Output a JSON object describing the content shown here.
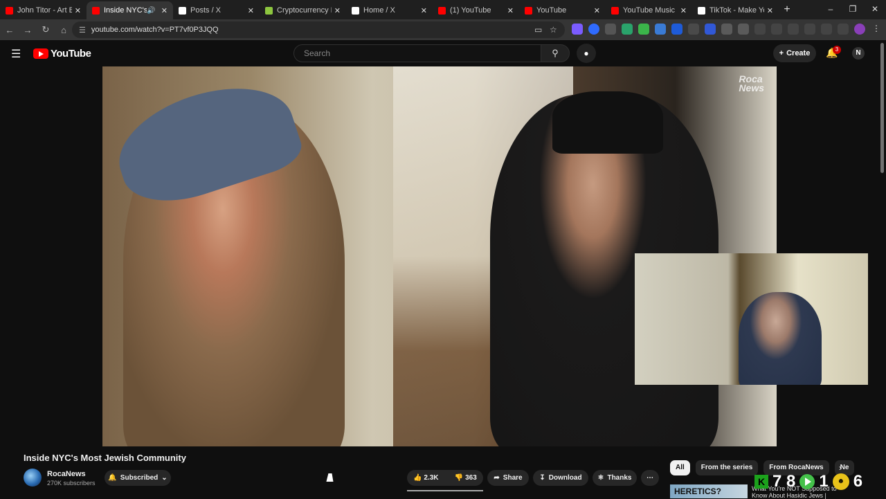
{
  "browser": {
    "tabs": [
      {
        "title": "John Titor - Art Bell C",
        "favicon": "youtube-icon",
        "color": "#ff0000"
      },
      {
        "title": "Inside NYC's Most",
        "favicon": "youtube-icon",
        "color": "#ff0000",
        "active": true,
        "audio": "speaker-icon"
      },
      {
        "title": "Posts / X",
        "favicon": "x-icon",
        "color": "#ffffff"
      },
      {
        "title": "Cryptocurrency Prices",
        "favicon": "crypto-icon",
        "color": "#8dc63f"
      },
      {
        "title": "Home / X",
        "favicon": "x-icon",
        "color": "#ffffff"
      },
      {
        "title": "(1) YouTube",
        "favicon": "youtube-icon",
        "color": "#ff0000"
      },
      {
        "title": "YouTube",
        "favicon": "youtube-icon",
        "color": "#ff0000"
      },
      {
        "title": "YouTube Music",
        "favicon": "youtube-music-icon",
        "color": "#ff0000"
      },
      {
        "title": "TikTok - Make Your D",
        "favicon": "tiktok-icon",
        "color": "#ffffff"
      }
    ],
    "url": "youtube.com/watch?v=PT7vf0P3JQQ"
  },
  "header": {
    "logo_text": "YouTube",
    "search_placeholder": "Search",
    "create_label": "Create",
    "notification_count": "3",
    "avatar_initial": "N"
  },
  "video": {
    "watermark_line1": "Roca",
    "watermark_line2": "News",
    "title": "Inside NYC's Most Jewish Community"
  },
  "channel": {
    "name": "RocaNews",
    "subscribers": "270K subscribers",
    "subscribe_label": "Subscribed"
  },
  "actions": {
    "likes": "2.3K",
    "dislikes": "363",
    "share": "Share",
    "download": "Download",
    "thanks": "Thanks"
  },
  "recommendations": {
    "chips": [
      "All",
      "From the series",
      "From RocaNews",
      "Ne"
    ],
    "first_thumb_text": "HERETICS?",
    "first_title": "What You're NOT Supposed to Know About Hasidic Jews |"
  },
  "overlay": {
    "score_left": "7 8",
    "score_mid": "1",
    "score_right": "6"
  }
}
